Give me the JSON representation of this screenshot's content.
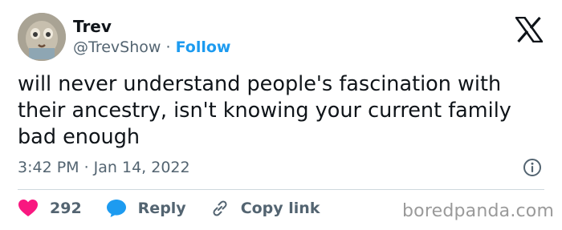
{
  "author": {
    "name": "Trev",
    "handle": "@TrevShow",
    "separator": "·",
    "follow_label": "Follow"
  },
  "tweet": {
    "text": "will never understand people's fascination with their ancestry, isn't knowing your current family bad enough",
    "timestamp": "3:42 PM · Jan 14, 2022"
  },
  "actions": {
    "likes_count": "292",
    "reply_label": "Reply",
    "copy_link_label": "Copy link"
  },
  "watermark": "boredpanda.com",
  "colors": {
    "accent": "#1d9bf0",
    "like": "#f91880",
    "text": "#0f1419",
    "muted": "#536471"
  },
  "icons": {
    "brand": "x-logo-icon",
    "info": "info-icon",
    "like": "heart-icon",
    "reply": "reply-icon",
    "copy_link": "link-icon"
  }
}
